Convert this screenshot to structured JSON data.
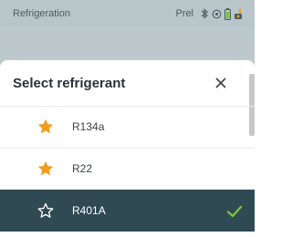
{
  "status_bar": {
    "title": "Refrigeration",
    "mode": "Prel",
    "icons": [
      "bluetooth-icon",
      "settings-icon",
      "battery-icon",
      "sensor-icon"
    ]
  },
  "dialog": {
    "title": "Select refrigerant",
    "close_icon": "close-icon"
  },
  "refrigerants": [
    {
      "name": "R134a",
      "favorite": true,
      "selected": false
    },
    {
      "name": "R22",
      "favorite": true,
      "selected": false
    },
    {
      "name": "R401A",
      "favorite": false,
      "selected": true
    }
  ],
  "colors": {
    "star_filled": "#F39B1E",
    "selected_row": "#2F4A53",
    "check": "#7CC142"
  }
}
